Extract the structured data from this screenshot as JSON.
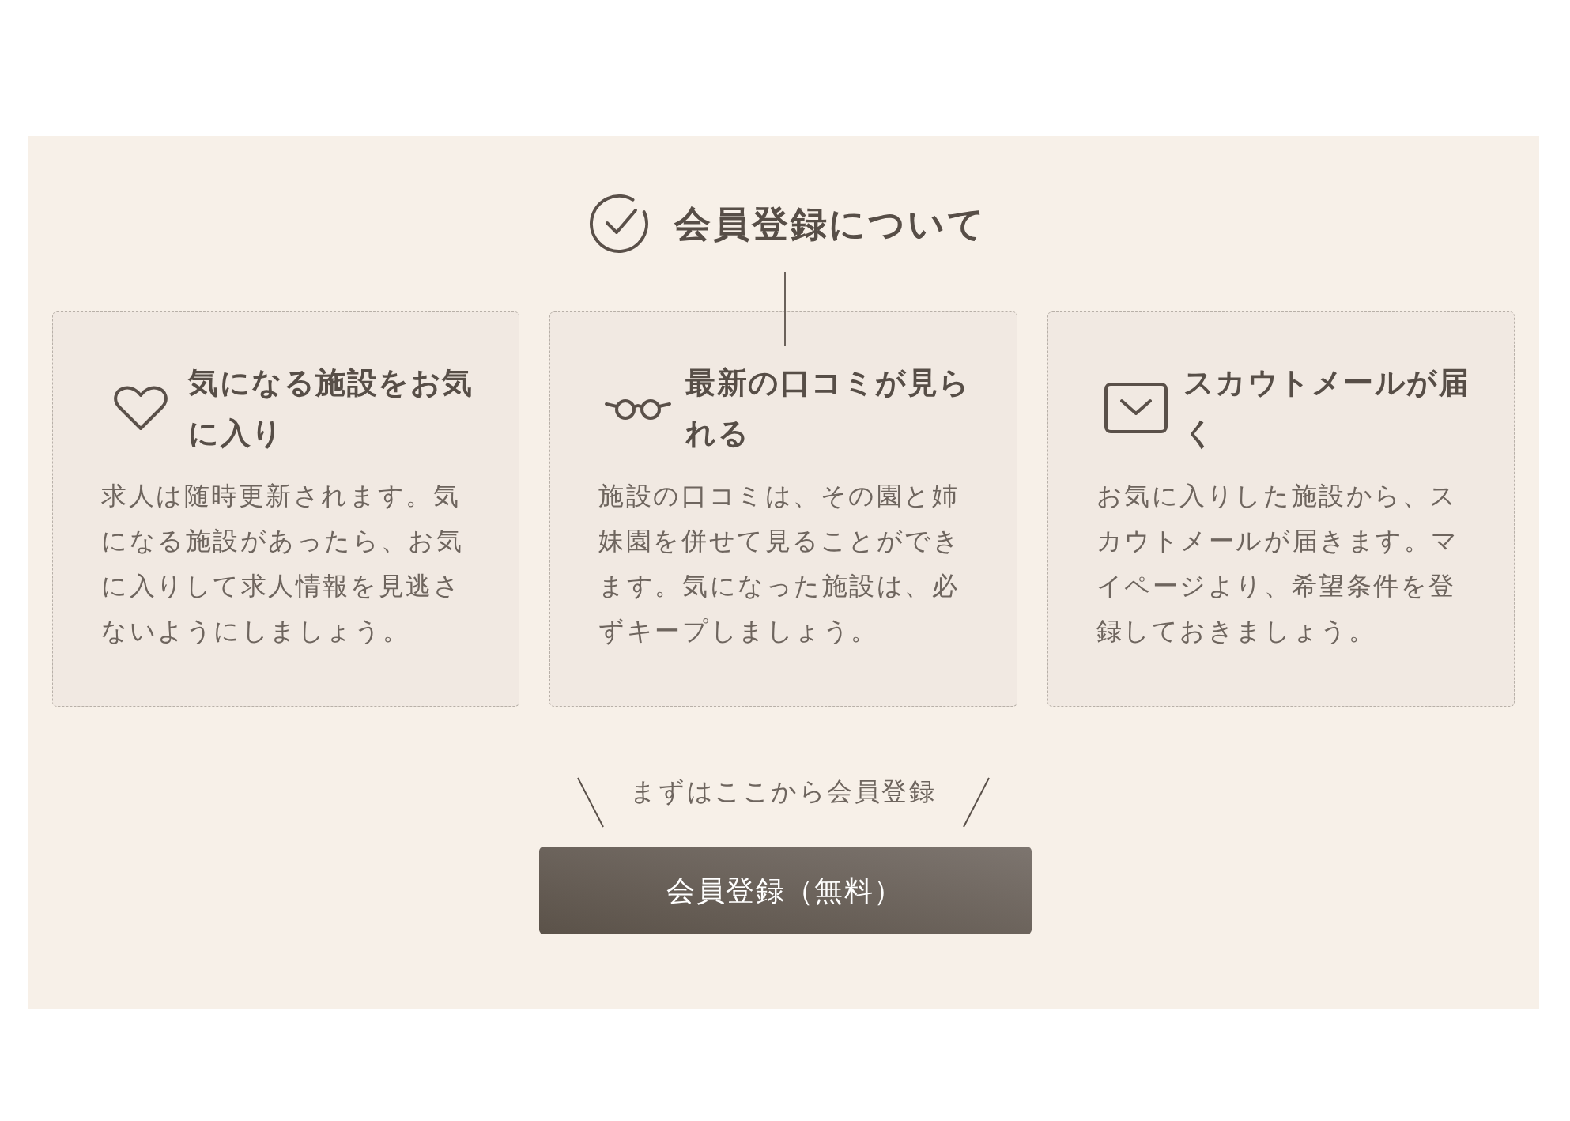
{
  "title": "会員登録について",
  "features": [
    {
      "kind": "heart",
      "heading": "気になる施設をお気に入り",
      "body": "求人は随時更新されます。気になる施設があったら、お気に入りして求人情報を見逃さないようにしましょう。"
    },
    {
      "kind": "glasses",
      "heading": "最新の口コミが見られる",
      "body": "施設の口コミは、その園と姉妹園を併せて見ることができます。気になった施設は、必ずキープしましょう。"
    },
    {
      "kind": "envelope",
      "heading": "スカウトメールが届く",
      "body": "お気に入りした施設から、スカウトメールが届きます。マイページより、希望条件を登録しておきましょう。"
    }
  ],
  "cta": {
    "lead": "まずはここから会員登録",
    "button": "会員登録（無料）"
  }
}
